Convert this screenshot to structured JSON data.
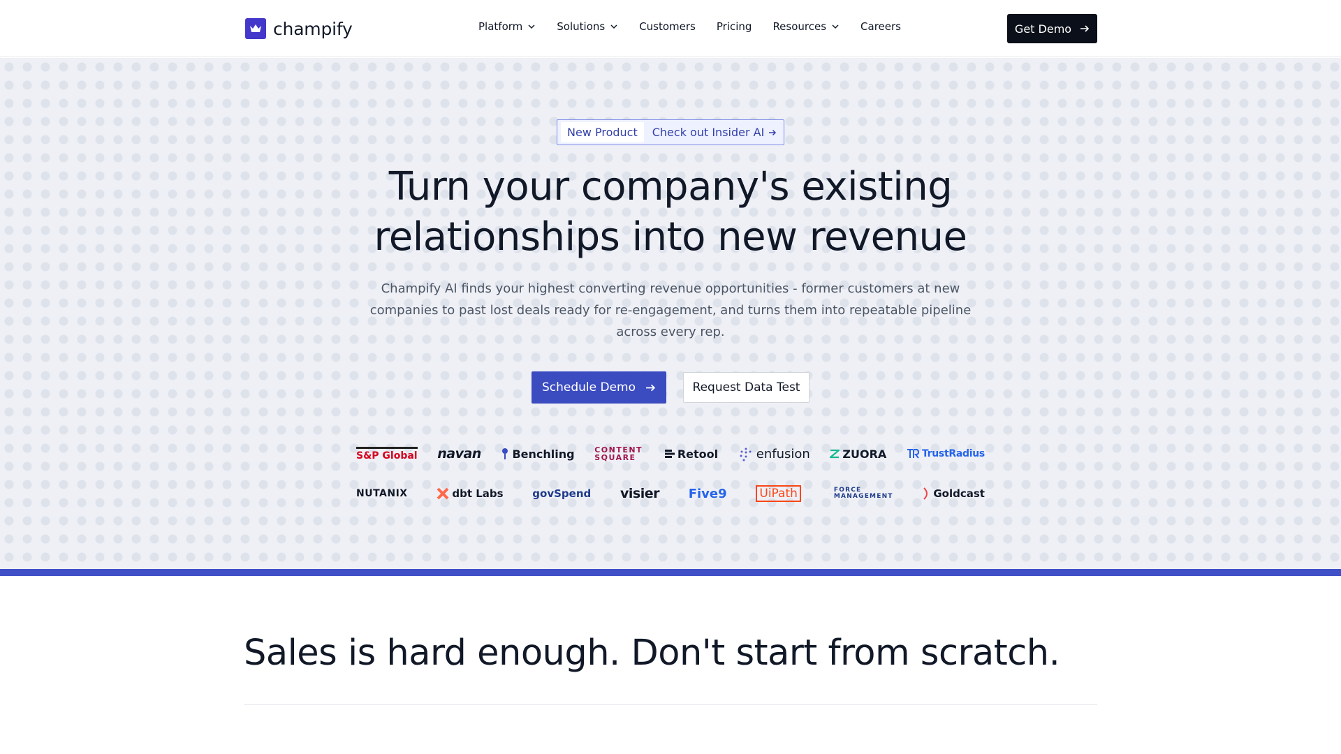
{
  "brand": {
    "name": "champify",
    "color": "#4338ca"
  },
  "nav": {
    "items": [
      {
        "label": "Platform",
        "dropdown": true
      },
      {
        "label": "Solutions",
        "dropdown": true
      },
      {
        "label": "Customers",
        "dropdown": false
      },
      {
        "label": "Pricing",
        "dropdown": false
      },
      {
        "label": "Resources",
        "dropdown": true
      },
      {
        "label": "Careers",
        "dropdown": false
      }
    ],
    "cta": "Get Demo"
  },
  "hero": {
    "badge_pill": "New Product",
    "badge_link": "Check out Insider AI",
    "headline_line1": "Turn your company's existing",
    "headline_line2": "relationships into new revenue",
    "subtext_line1": "Champify AI finds your highest converting revenue opportunities - former customers at new",
    "subtext_line2": "companies to past lost deals ready for re-engagement, and turns them into repeatable pipeline",
    "subtext_line3": "across every rep.",
    "primary_button": "Schedule Demo",
    "secondary_button": "Request Data Test",
    "accent_color": "#3b4cc0"
  },
  "customers": {
    "row1": [
      "S&P Global",
      "navan",
      "Benchling",
      "CONTENT SQUARE",
      "Retool",
      "enfusion",
      "ZUORA",
      "TrustRadius"
    ],
    "row2": [
      "NUTANIX",
      "dbt Labs",
      "govSpend",
      "visier",
      "Five9",
      "UiPath",
      "FORCE MANAGEMENT",
      "Goldcast"
    ]
  },
  "section": {
    "title": "Sales is hard enough. Don't start from scratch."
  }
}
